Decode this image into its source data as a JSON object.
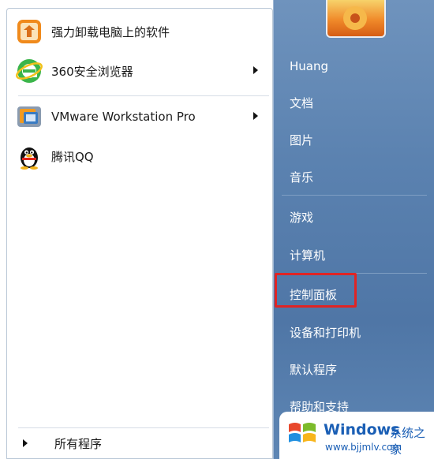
{
  "programs": [
    {
      "label": "强力卸载电脑上的软件",
      "icon": "uninstall-box-icon",
      "has_submenu": false
    },
    {
      "label": "360安全浏览器",
      "icon": "360-browser-icon",
      "has_submenu": true
    },
    {
      "label": "VMware Workstation Pro",
      "icon": "vmware-icon",
      "has_submenu": true
    },
    {
      "label": "腾讯QQ",
      "icon": "qq-penguin-icon",
      "has_submenu": false
    }
  ],
  "all_programs": "所有程序",
  "right_links": [
    "Huang",
    "文档",
    "图片",
    "音乐",
    "游戏",
    "计算机",
    "控制面板",
    "设备和打印机",
    "默认程序",
    "帮助和支持"
  ],
  "highlighted_link": "控制面板",
  "watermark": {
    "brand": "Windows",
    "suffix": "系统之家",
    "url": "www.bjjmlv.com"
  },
  "colors": {
    "right_pane": "#5b82b0",
    "highlight_box": "#e02424",
    "watermark": "#1b5fb5"
  }
}
